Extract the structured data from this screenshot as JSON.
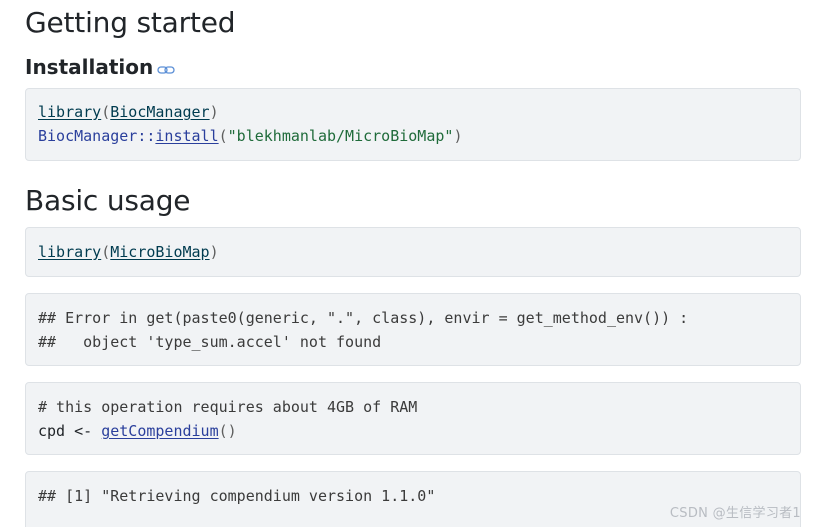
{
  "headings": {
    "getting_started": "Getting started",
    "installation": "Installation",
    "basic_usage": "Basic usage"
  },
  "code": {
    "block1": {
      "line1_fn": "library",
      "line1_open": "(",
      "line1_arg": "BiocManager",
      "line1_close": ")",
      "line2_ns": "BiocManager::",
      "line2_fn": "install",
      "line2_open": "(",
      "line2_str": "\"blekhmanlab/MicroBioMap\"",
      "line2_close": ")"
    },
    "block2": {
      "line1_fn": "library",
      "line1_open": "(",
      "line1_arg": "MicroBioMap",
      "line1_close": ")"
    },
    "block3": {
      "line1": "## Error in get(paste0(generic, \".\", class), envir = get_method_env()) :",
      "line2": "##   object 'type_sum.accel' not found"
    },
    "block4": {
      "line1": "# this operation requires about 4GB of RAM",
      "line2_pre": "cpd <- ",
      "line2_fn": "getCompendium",
      "line2_post": "()"
    },
    "block5": {
      "line1": "## [1] \"Retrieving compendium version 1.1.0\""
    }
  },
  "watermark": "CSDN @生信学习者1",
  "colors": {
    "code_bg": "#f1f3f5",
    "code_border": "#dee2e6",
    "link_fn": "#2a3f9c",
    "string": "#1f6b3a"
  }
}
